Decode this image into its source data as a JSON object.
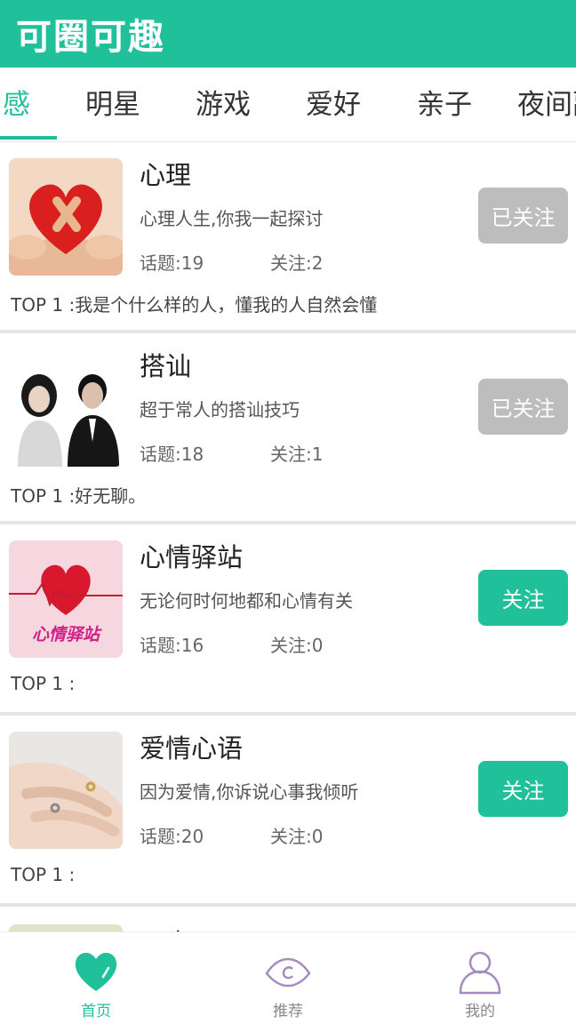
{
  "app": {
    "title": "可圈可趣",
    "accent_color": "#1fc09a"
  },
  "tabs": [
    {
      "label": "感",
      "active": true
    },
    {
      "label": "明星",
      "active": false
    },
    {
      "label": "游戏",
      "active": false
    },
    {
      "label": "爱好",
      "active": false
    },
    {
      "label": "亲子",
      "active": false
    },
    {
      "label": "夜间副",
      "active": false
    }
  ],
  "cards": [
    {
      "title": "心理",
      "desc": "心理人生,你我一起探讨",
      "topics": "话题:19",
      "follows": "关注:2",
      "top": "TOP 1 :我是个什么样的人，懂我的人自然会懂",
      "button": "已关注",
      "followed": true,
      "image": "broken-heart-in-hands"
    },
    {
      "title": "搭讪",
      "desc": "超于常人的搭讪技巧",
      "topics": "话题:18",
      "follows": "关注:1",
      "top": "TOP 1 :好无聊。",
      "button": "已关注",
      "followed": true,
      "image": "couple-photo"
    },
    {
      "title": "心情驿站",
      "desc": "无论何时何地都和心情有关",
      "topics": "话题:16",
      "follows": "关注:0",
      "top": "TOP 1 :",
      "button": "关注",
      "followed": false,
      "image": "heart-heartbeat",
      "image_text": "心情驿站"
    },
    {
      "title": "爱情心语",
      "desc": "因为爱情,你诉说心事我倾听",
      "topics": "话题:20",
      "follows": "关注:0",
      "top": "TOP 1 :",
      "button": "关注",
      "followed": false,
      "image": "hands-with-rings"
    }
  ],
  "partial_card": {
    "title": "网商"
  },
  "bottom_nav": [
    {
      "label": "首页",
      "icon": "heart-icon",
      "active": true
    },
    {
      "label": "推荐",
      "icon": "eye-icon",
      "active": false
    },
    {
      "label": "我的",
      "icon": "user-icon",
      "active": false
    }
  ]
}
